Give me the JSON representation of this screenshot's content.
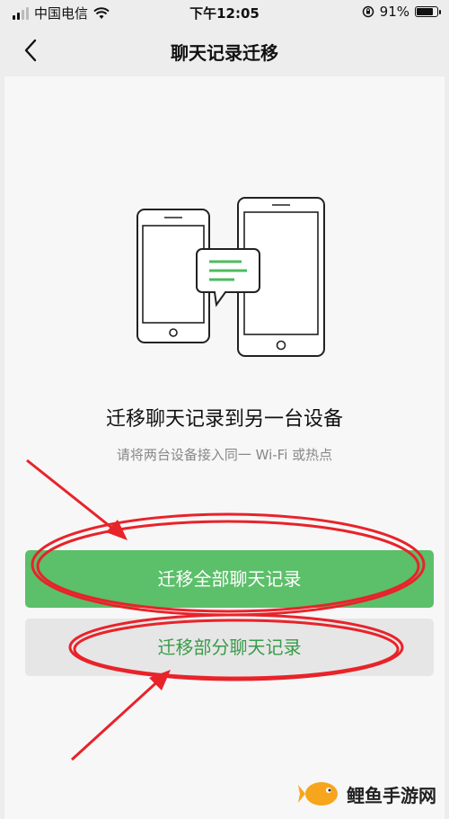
{
  "status_bar": {
    "carrier": "中国电信",
    "time": "下午12:05",
    "battery": "91%",
    "battery_level": 0.91
  },
  "nav": {
    "title": "聊天记录迁移"
  },
  "main": {
    "headline": "迁移聊天记录到另一台设备",
    "subtext": "请将两台设备接入同一 Wi-Fi 或热点",
    "primary_button": "迁移全部聊天记录",
    "secondary_button": "迁移部分聊天记录"
  },
  "colors": {
    "accent_green": "#5cbf6a",
    "annotation_red": "#e8232a"
  },
  "watermark": {
    "text": "鲤鱼手游网"
  },
  "icons": [
    "signal-icon",
    "wifi-icon",
    "orientation-lock-icon",
    "battery-icon",
    "back-icon",
    "phones-transfer-illustration",
    "chat-bubble-icon",
    "carp-logo-icon"
  ]
}
